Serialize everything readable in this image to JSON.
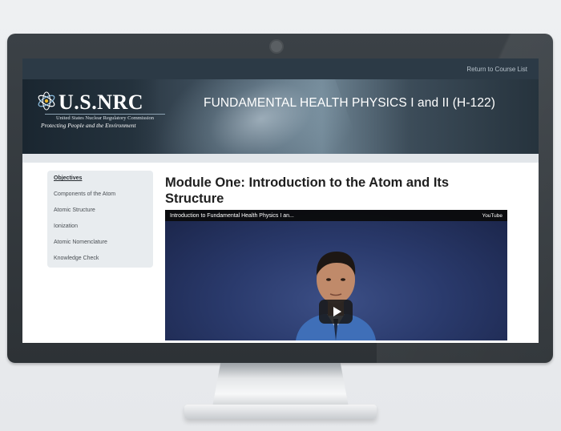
{
  "topbar": {
    "return_link": "Return to Course List"
  },
  "banner": {
    "logo_text": "U.S.NRC",
    "logo_subtitle": "United States Nuclear Regulatory Commission",
    "logo_tagline": "Protecting People and the Environment",
    "course_title": "FUNDAMENTAL HEALTH PHYSICS I and II (H-122)"
  },
  "sidebar": {
    "items": [
      {
        "label": "Objectives",
        "active": true
      },
      {
        "label": "Components of the Atom"
      },
      {
        "label": "Atomic Structure"
      },
      {
        "label": "Ionization"
      },
      {
        "label": "Atomic Nomenclature"
      },
      {
        "label": "Knowledge Check"
      }
    ]
  },
  "main": {
    "module_title": "Module One: Introduction to the Atom and Its Structure",
    "video": {
      "title": "Introduction to Fundamental Health Physics I an...",
      "provider": "YouTube",
      "play_icon": "play-icon"
    }
  },
  "colors": {
    "topbar": "#2c3a46",
    "sidebar_bg": "#e8ecef",
    "monitor_frame": "#33393d"
  }
}
